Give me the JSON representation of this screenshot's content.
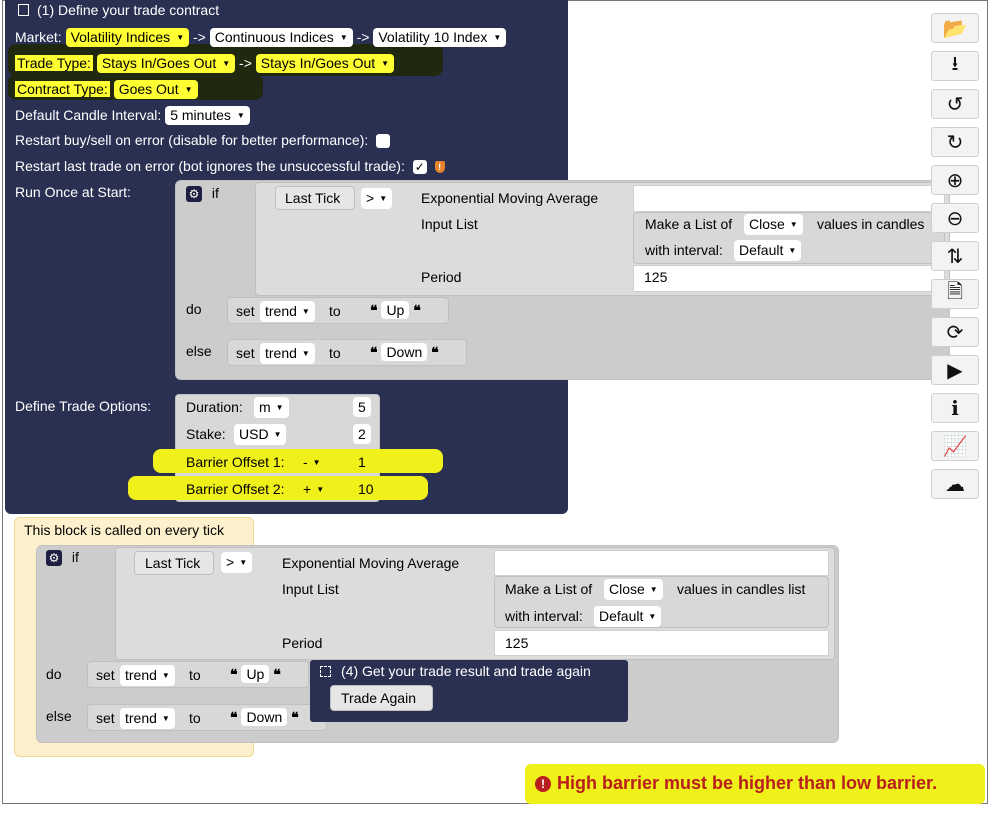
{
  "trade_contract": {
    "title": "(1) Define your trade contract",
    "market_label": "Market:",
    "market": [
      "Volatility Indices",
      "Continuous Indices",
      "Volatility 10 Index"
    ],
    "arrow": "->",
    "trade_type_label": "Trade Type:",
    "trade_type": [
      "Stays In/Goes Out",
      "Stays In/Goes Out"
    ],
    "contract_type_label": "Contract Type:",
    "contract_type": "Goes Out",
    "candle_label": "Default Candle Interval:",
    "candle_interval": "5 minutes",
    "restart_buysell_label": "Restart buy/sell on error  (disable for better performance):",
    "restart_last_label": "Restart last trade on error  (bot ignores the unsuccessful trade):",
    "checkmark": "✓",
    "shield": "!",
    "run_once_label": "Run Once at Start:",
    "define_options_label": "Define Trade Options:"
  },
  "if_block": {
    "if": "if",
    "last_tick": "Last Tick",
    "op": ">",
    "ema": "Exponential Moving Average",
    "input_list": "Input List",
    "make_list_a": "Make a List of",
    "close": "Close",
    "make_list_b": "values in candles list",
    "make_list_b_cut": "values in candles",
    "with_interval": "with interval:",
    "interval_value": "Default",
    "period": "Period",
    "period_value": "125",
    "do": "do",
    "else": "else",
    "set": "set",
    "var": "trend",
    "to": "to",
    "quote": "❝",
    "up": "Up",
    "down": "Down"
  },
  "trade_options": {
    "duration_label": "Duration:",
    "duration_unit": "m",
    "duration_value": "5",
    "stake_label": "Stake:",
    "stake_currency": "USD",
    "stake_value": "2",
    "barrier1_label": "Barrier Offset 1:",
    "barrier1_sign": "-",
    "barrier1_value": "1",
    "barrier2_label": "Barrier Offset 2:",
    "barrier2_sign": "+",
    "barrier2_value": "10"
  },
  "tick_block": {
    "title": "This block is called on every tick"
  },
  "trade_again_block": {
    "title": "(4) Get your trade result and trade again",
    "button": "Trade Again"
  },
  "toolbar": [
    "folder-open",
    "download",
    "undo",
    "redo",
    "zoom-in",
    "zoom-out",
    "sort",
    "file-text",
    "refresh",
    "play",
    "info",
    "chart-line",
    "cloud"
  ],
  "error": {
    "message": "High barrier must be higher than low barrier.",
    "icon": "!"
  },
  "colors": {
    "dark_block": "#2a3052",
    "highlight": "#ffff33",
    "error": "#b81e1e"
  }
}
